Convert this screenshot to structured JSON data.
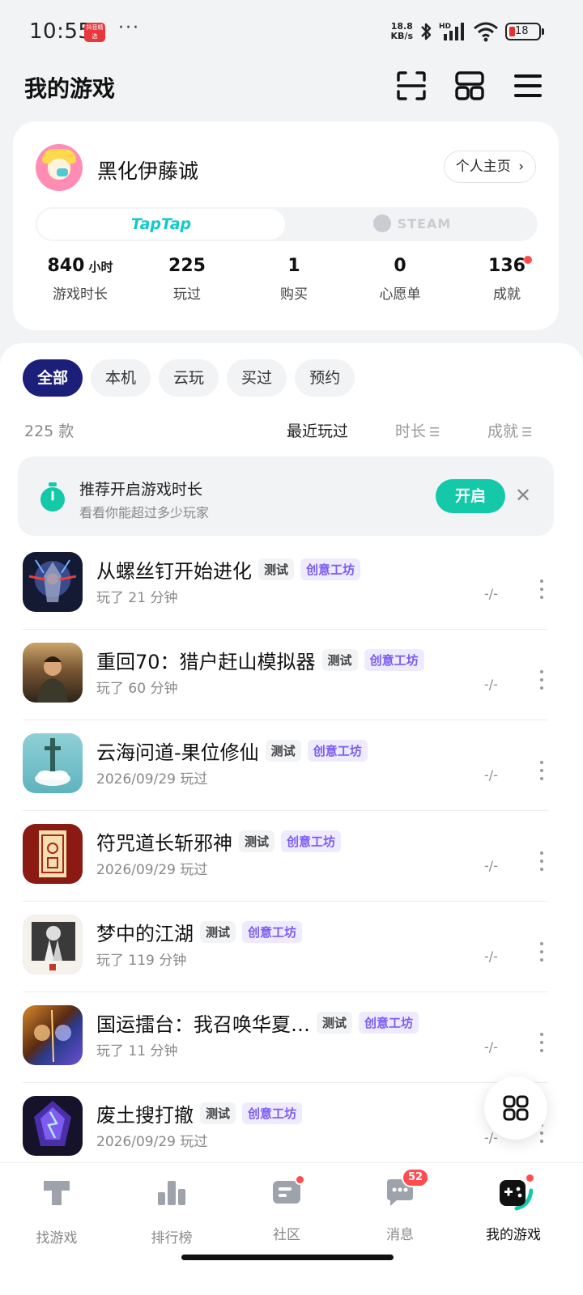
{
  "status_bar": {
    "time": "10:55",
    "app_badge_text": "抖音精选",
    "more": "···",
    "net_speed_value": "18.8",
    "net_speed_unit": "KB/s",
    "signal_label": "HD",
    "battery": "18"
  },
  "header": {
    "title": "我的游戏",
    "icons": [
      "scan-icon",
      "layout-icon",
      "menu-icon"
    ]
  },
  "profile": {
    "username": "黑化伊藤诚",
    "homepage_label": "个人主页",
    "platforms": [
      "TapTap",
      "STEAM"
    ],
    "active_platform": "TapTap",
    "stats": [
      {
        "value": "840",
        "unit": "小时",
        "label": "游戏时长"
      },
      {
        "value": "225",
        "unit": "",
        "label": "玩过"
      },
      {
        "value": "1",
        "unit": "",
        "label": "购买"
      },
      {
        "value": "0",
        "unit": "",
        "label": "心愿单"
      },
      {
        "value": "136",
        "unit": "",
        "label": "成就"
      }
    ]
  },
  "filters": {
    "chips": [
      "全部",
      "本机",
      "云玩",
      "买过",
      "预约"
    ],
    "active": "全部"
  },
  "list_meta": {
    "count": "225 款",
    "sort_options": [
      "最近玩过",
      "时长",
      "成就"
    ],
    "active_sort": "最近玩过"
  },
  "recommendation": {
    "title": "推荐开启游戏时长",
    "subtitle": "看看你能超过多少玩家",
    "button": "开启",
    "close": "✕"
  },
  "games": [
    {
      "name": "从螺丝钉开始进化",
      "tag_test": "测试",
      "tag_workshop": "创意工坊",
      "subtitle": "玩了 21 分钟",
      "score": "-/-"
    },
    {
      "name": "重回70：猎户赶山模拟器",
      "tag_test": "测试",
      "tag_workshop": "创意工坊",
      "subtitle": "玩了 60 分钟",
      "score": "-/-"
    },
    {
      "name": "云海问道-果位修仙",
      "tag_test": "测试",
      "tag_workshop": "创意工坊",
      "subtitle": "2026/09/29 玩过",
      "score": "-/-"
    },
    {
      "name": "符咒道长斩邪神",
      "tag_test": "测试",
      "tag_workshop": "创意工坊",
      "subtitle": "2026/09/29 玩过",
      "score": "-/-"
    },
    {
      "name": "梦中的江湖",
      "tag_test": "测试",
      "tag_workshop": "创意工坊",
      "subtitle": "玩了 119 分钟",
      "score": "-/-"
    },
    {
      "name": "国运擂台：我召唤华夏…",
      "tag_test": "测试",
      "tag_workshop": "创意工坊",
      "subtitle": "玩了 11 分钟",
      "score": "-/-"
    },
    {
      "name": "废土搜打撤",
      "tag_test": "测试",
      "tag_workshop": "创意工坊",
      "subtitle": "2026/09/29 玩过",
      "score": "-/-"
    }
  ],
  "bottom_nav": {
    "items": [
      {
        "label": "找游戏",
        "icon": "find-game-icon"
      },
      {
        "label": "排行榜",
        "icon": "ranking-icon"
      },
      {
        "label": "社区",
        "icon": "community-icon"
      },
      {
        "label": "消息",
        "icon": "message-icon",
        "badge": "52"
      },
      {
        "label": "我的游戏",
        "icon": "my-games-icon"
      }
    ],
    "active": "我的游戏"
  },
  "colors": {
    "accent_teal": "#14c9a8",
    "chip_active": "#1b1f7a",
    "workshop_purple": "#7a5cf0",
    "badge_red": "#ff4d4f"
  }
}
